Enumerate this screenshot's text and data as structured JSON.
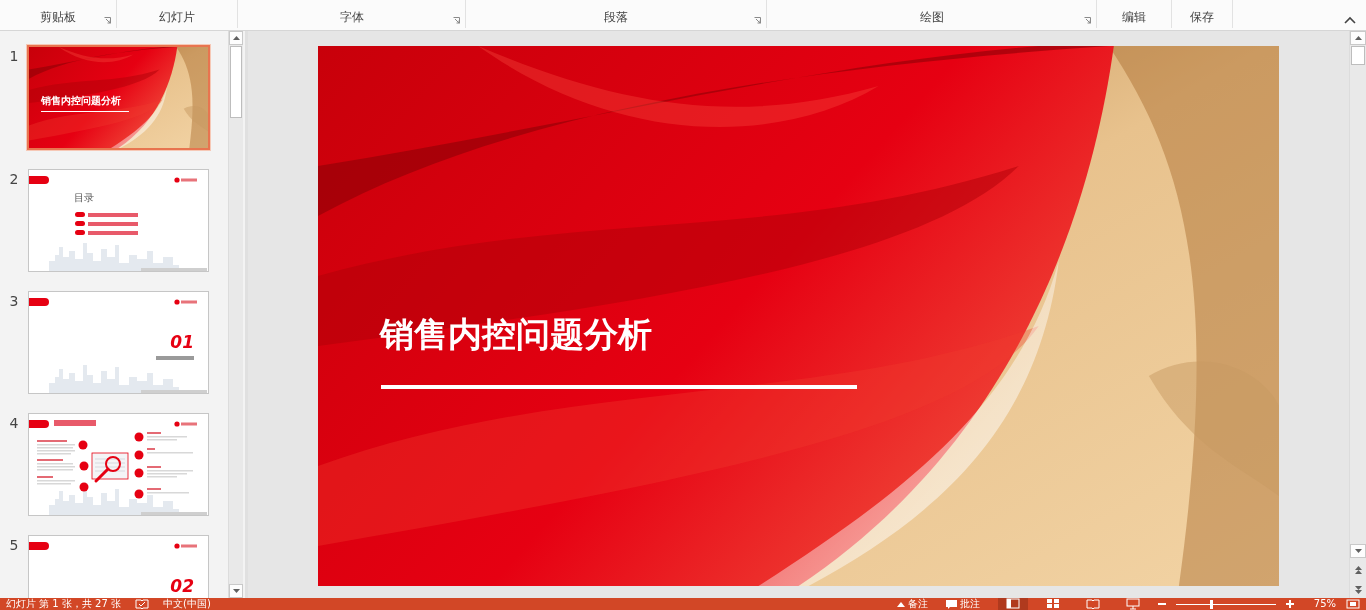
{
  "ribbon": {
    "groups": [
      {
        "label": "剪贴板",
        "launcher": true
      },
      {
        "label": "幻灯片",
        "launcher": false
      },
      {
        "label": "字体",
        "launcher": true
      },
      {
        "label": "段落",
        "launcher": true
      },
      {
        "label": "绘图",
        "launcher": true
      },
      {
        "label": "编辑",
        "launcher": false
      },
      {
        "label": "保存",
        "launcher": false
      }
    ]
  },
  "thumbnails": [
    {
      "number": "1",
      "selected": true,
      "kind": "title",
      "title": "销售内控问题分析"
    },
    {
      "number": "2",
      "selected": false,
      "kind": "toc",
      "heading": "目录"
    },
    {
      "number": "3",
      "selected": false,
      "kind": "section",
      "section_number": "01"
    },
    {
      "number": "4",
      "selected": false,
      "kind": "content"
    },
    {
      "number": "5",
      "selected": false,
      "kind": "section",
      "section_number": "02"
    }
  ],
  "slide": {
    "title": "销售内控问题分析"
  },
  "status_bar": {
    "slide_info": "幻灯片 第 1 张，共 27 张",
    "language": "中文(中国)",
    "notes": "备注",
    "comments": "批注",
    "views": [
      {
        "selected": true
      },
      {
        "selected": false
      },
      {
        "selected": false
      },
      {
        "selected": false
      }
    ],
    "zoom_slider": {
      "level": 0.35
    },
    "zoom": "75%"
  }
}
